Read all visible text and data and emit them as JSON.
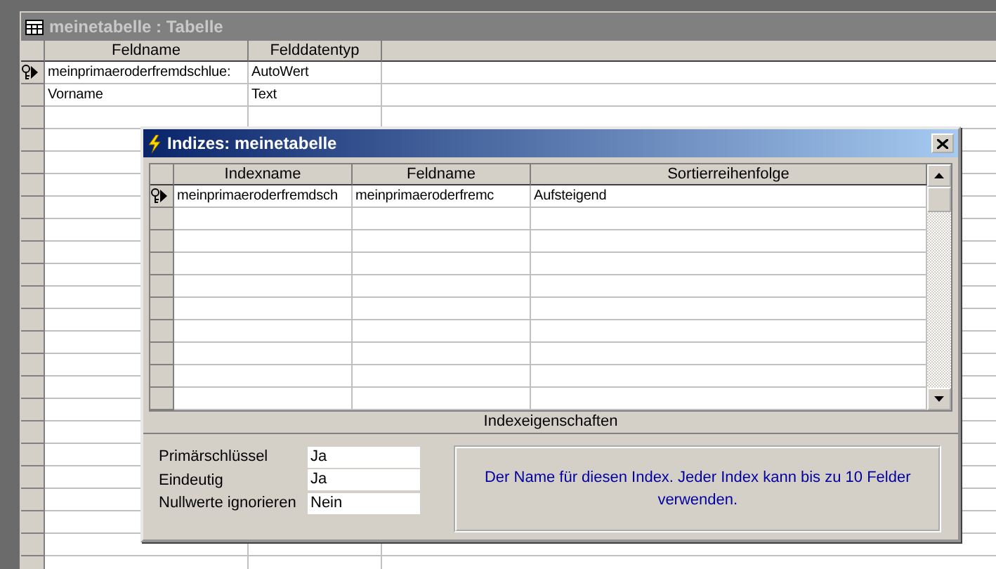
{
  "window": {
    "title": "meinetabelle : Tabelle",
    "active": false
  },
  "table": {
    "columns": [
      "Feldname",
      "Felddatentyp"
    ],
    "rows": [
      {
        "field_name": "meinprimaeroderfremdschlue:",
        "data_type": "AutoWert",
        "primary_key": true,
        "current": true
      },
      {
        "field_name": "Vorname",
        "data_type": "Text",
        "primary_key": false,
        "current": false
      }
    ]
  },
  "dialog": {
    "title": "Indizes: meinetabelle",
    "active": true,
    "columns": [
      "Indexname",
      "Feldname",
      "Sortierreihenfolge"
    ],
    "rows": [
      {
        "index_name": "meinprimaeroderfremdsch",
        "field_name": "meinprimaeroderfremc",
        "sort_order": "Aufsteigend",
        "primary_key": true,
        "current": true
      }
    ],
    "properties_title": "Indexeigenschaften",
    "properties": [
      {
        "label": "Primärschlüssel",
        "value": "Ja"
      },
      {
        "label": "Eindeutig",
        "value": "Ja"
      },
      {
        "label": "Nullwerte ignorieren",
        "value": "Nein"
      }
    ],
    "help_text": "Der Name für diesen Index. Jeder Index kann bis zu 10 Felder verwenden."
  }
}
